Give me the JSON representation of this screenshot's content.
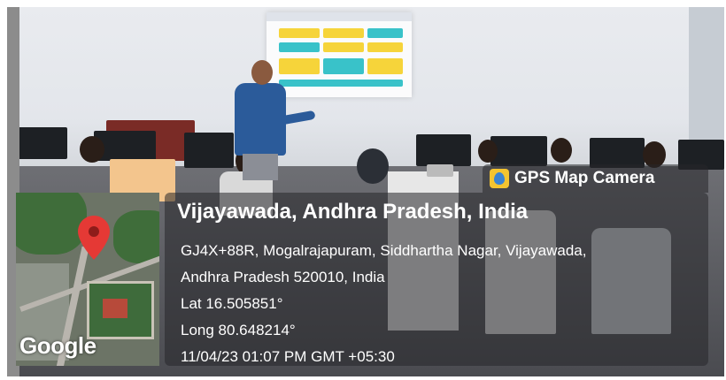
{
  "watermark": {
    "app_name": "GPS Map Camera",
    "app_icon": "gps-map-camera-icon",
    "map_provider": "Google",
    "location_title": "Vijayawada, Andhra Pradesh, India",
    "address_line_1": "GJ4X+88R, Mogalrajapuram, Siddhartha Nagar, Vijayawada,",
    "address_line_2": "Andhra Pradesh 520010, India",
    "latitude": "Lat 16.505851°",
    "longitude": "Long 80.648214°",
    "datetime": "11/04/23 01:07 PM GMT +05:30",
    "pin_icon": "location-pin-icon",
    "pin_color": "#e53935"
  },
  "scene": {
    "description_colors": {
      "presenter_shirt": "#2b5b9a",
      "projection_bg": "#fbfbfc",
      "tile_yellow": "#f6d43a",
      "tile_teal": "#39c2c9"
    }
  }
}
